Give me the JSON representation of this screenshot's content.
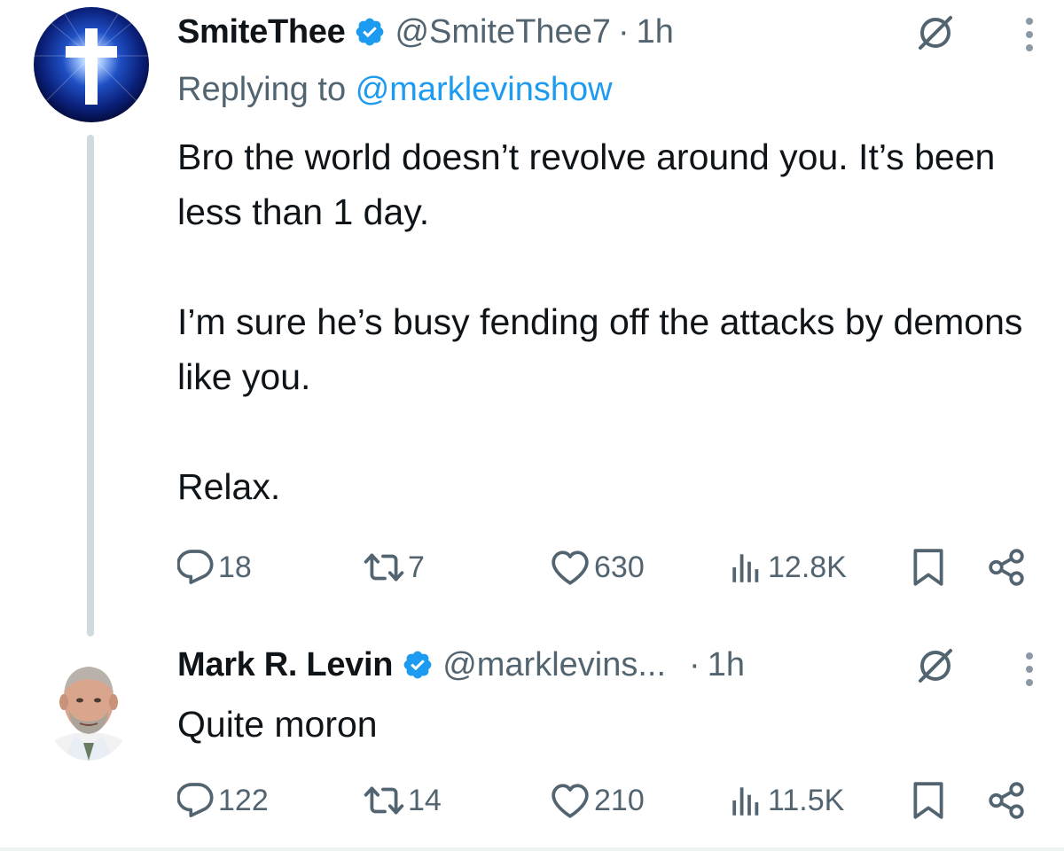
{
  "tweets": [
    {
      "name": "SmiteThee",
      "handle": "@SmiteThee7",
      "separator": "·",
      "time": "1h",
      "replying_label": "Replying to",
      "replying_handle": "@marklevinshow",
      "body": [
        "Bro the world doesn’t revolve around you. It’s been less than 1 day.",
        "I’m sure he’s busy fending off the attacks by demons like you.",
        "Relax."
      ],
      "replies": "18",
      "reposts": "7",
      "likes": "630",
      "views": "12.8K",
      "avatar_icon": "cross-icon"
    },
    {
      "name": "Mark R. Levin",
      "handle": "@marklevins...",
      "separator": "·",
      "time": "1h",
      "body": [
        "Quite moron"
      ],
      "replies": "122",
      "reposts": "14",
      "likes": "210",
      "views": "11.5K",
      "avatar_icon": "profile-photo"
    }
  ],
  "colors": {
    "text": "#0f1419",
    "secondary": "#536471",
    "accent": "#1d9bf0",
    "thread_line": "#cfd9de"
  }
}
